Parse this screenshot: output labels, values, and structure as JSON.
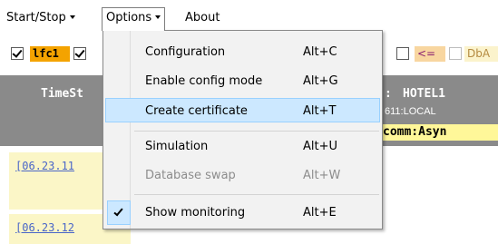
{
  "menubar": {
    "items": [
      {
        "label": "Start/Stop",
        "has_caret": true
      },
      {
        "label": "Options",
        "has_caret": true
      },
      {
        "label": "About",
        "has_caret": false
      }
    ]
  },
  "toolbar": {
    "lfc_label": "lfc1",
    "le_label": "<=",
    "db_label": "DbA"
  },
  "table": {
    "header_left": "TimeSt",
    "header_right": "HOTEL1",
    "header_right_prefix": ":",
    "sub_right": "611:LOCAL",
    "comm_label": "comm:Asyn",
    "log_rows": [
      "[06.23.11",
      "[06.23.12"
    ]
  },
  "options_menu": {
    "items": [
      {
        "label": "Configuration",
        "shortcut": "Alt+C"
      },
      {
        "label": "Enable config mode",
        "shortcut": "Alt+G"
      },
      {
        "label": "Create certificate",
        "shortcut": "Alt+T"
      },
      {
        "label": "Simulation",
        "shortcut": "Alt+U"
      },
      {
        "label": "Database swap",
        "shortcut": "Alt+W"
      },
      {
        "label": "Show monitoring",
        "shortcut": "Alt+E"
      }
    ],
    "highlighted": "Create certificate",
    "disabled": "Database swap",
    "checked": "Show monitoring"
  },
  "colors": {
    "highlight": "#cce8ff",
    "lfc_badge": "#f4a300",
    "header_band": "#8a8a8a",
    "comm_badge": "#fff799",
    "log_cell": "#fbf6c7"
  }
}
